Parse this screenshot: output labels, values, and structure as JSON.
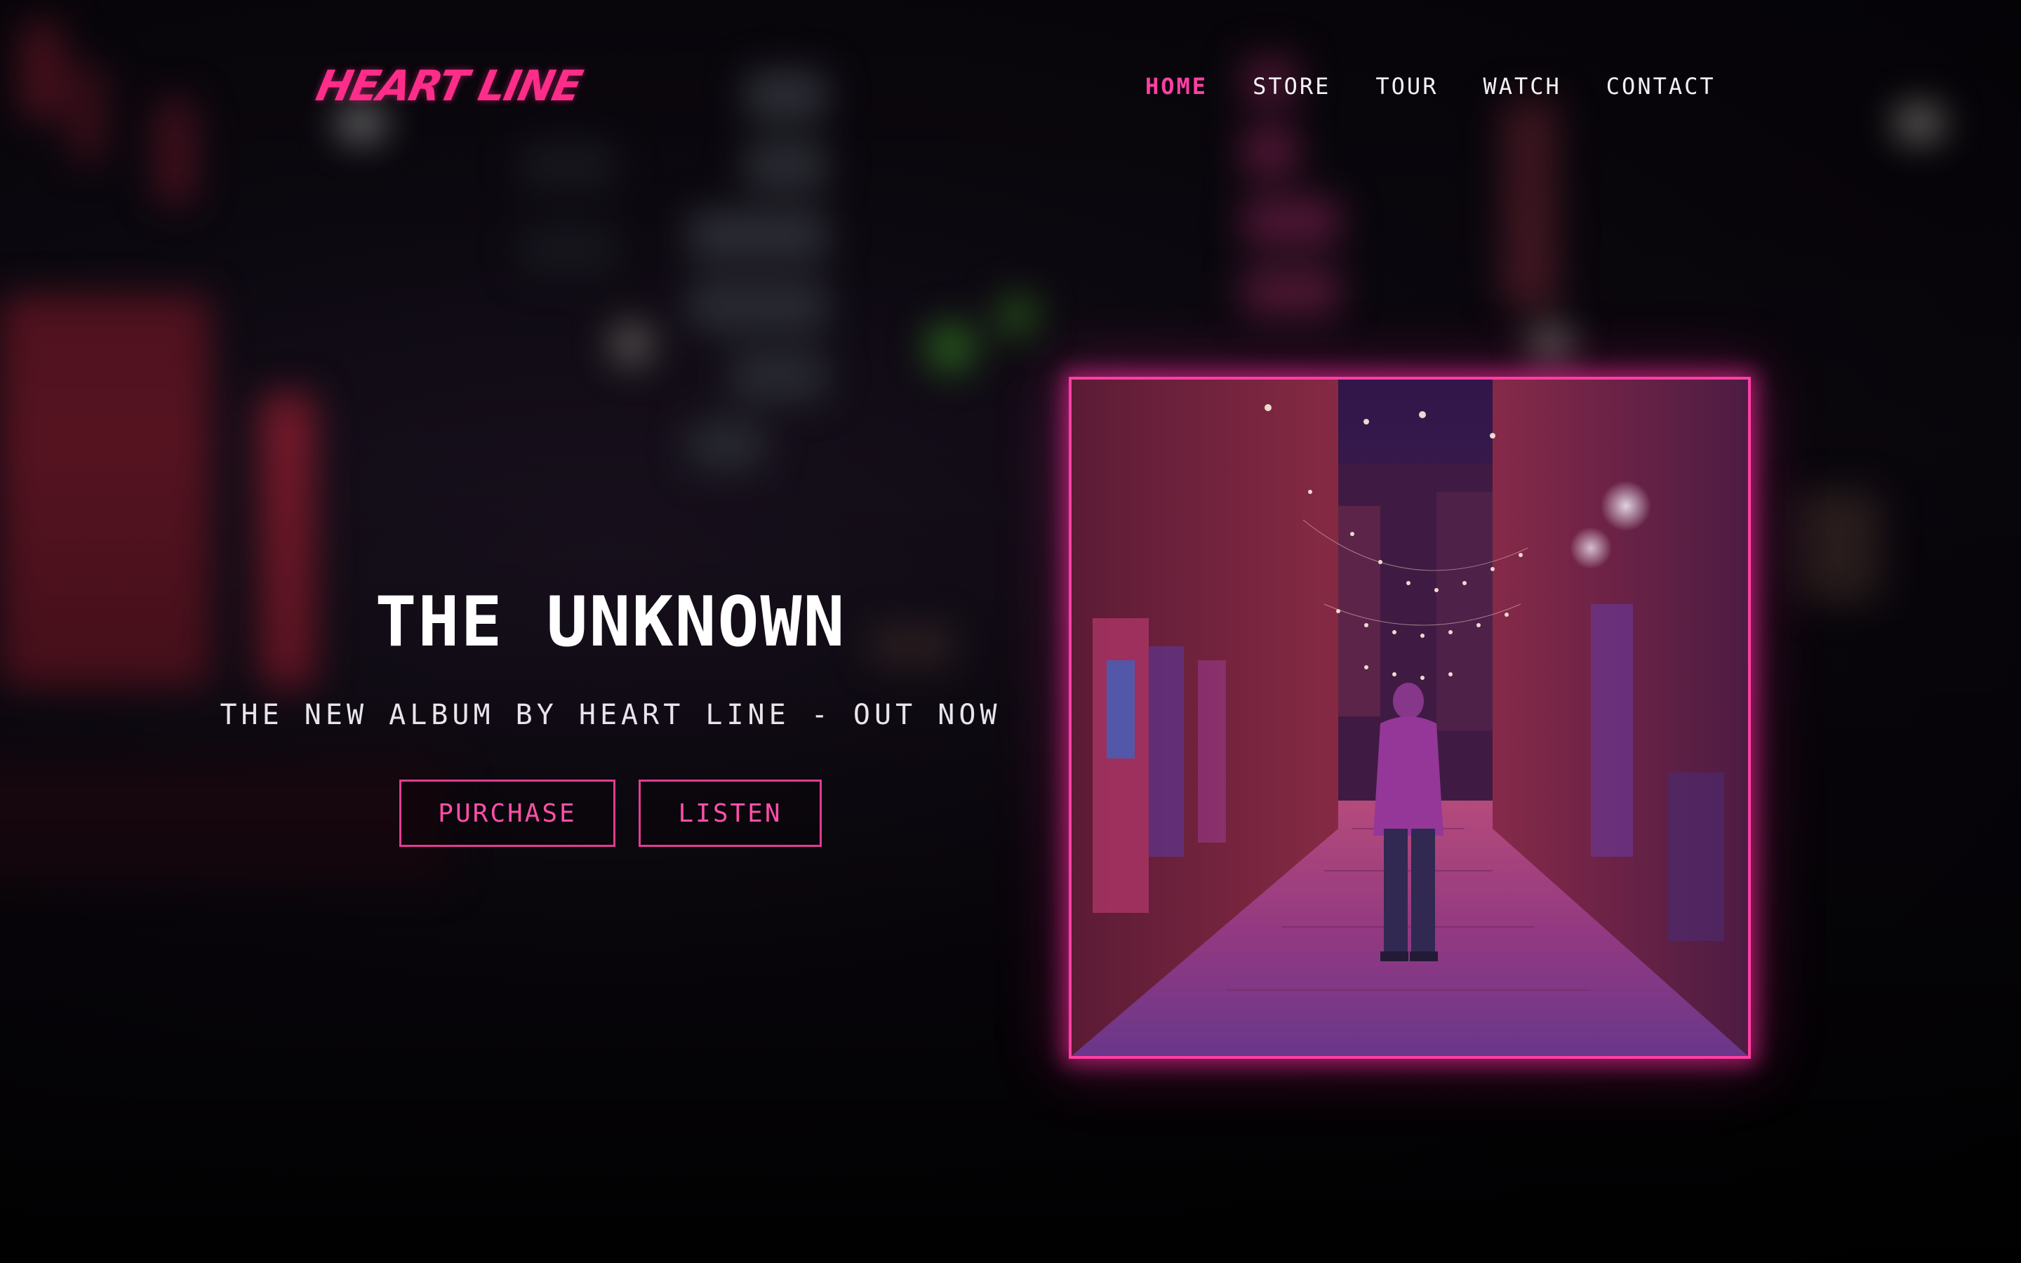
{
  "brand": {
    "logo_text": "HEART LINE",
    "accent_color": "#ff2d8a"
  },
  "nav": {
    "items": [
      {
        "label": "HOME",
        "active": true
      },
      {
        "label": "STORE",
        "active": false
      },
      {
        "label": "TOUR",
        "active": false
      },
      {
        "label": "WATCH",
        "active": false
      },
      {
        "label": "CONTACT",
        "active": false
      }
    ]
  },
  "hero": {
    "title": "THE UNKNOWN",
    "subtitle": "THE NEW ALBUM BY HEART LINE - OUT NOW",
    "buttons": {
      "purchase_label": "PURCHASE",
      "listen_label": "LISTEN"
    }
  },
  "album_art": {
    "subject": "hooded figure walking down a neon-lit graffiti alley"
  }
}
